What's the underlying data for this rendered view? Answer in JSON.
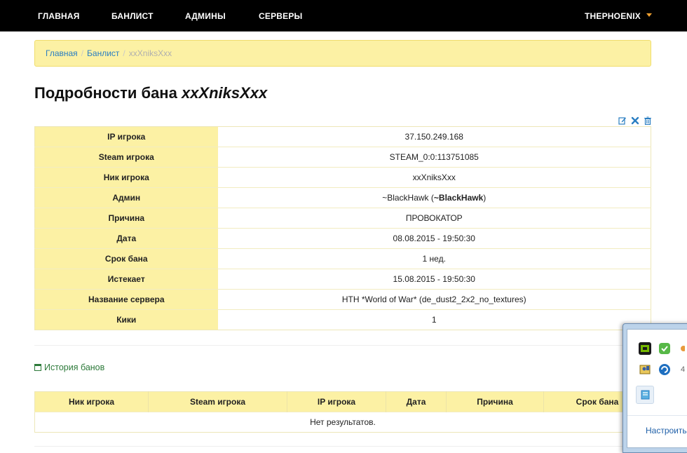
{
  "nav": {
    "items": [
      "ГЛАВНАЯ",
      "БАНЛИСТ",
      "АДМИНЫ",
      "СЕРВЕРЫ"
    ],
    "user": "THEPHOENIX"
  },
  "breadcrumb": {
    "items": [
      "Главная",
      "Банлист"
    ],
    "current": "xxXniksXxx"
  },
  "title": {
    "prefix": "Подробности бана",
    "name": "xxXniksXxx"
  },
  "actions": [
    "edit-icon",
    "unban-icon",
    "delete-icon"
  ],
  "details": [
    {
      "label": "IP игрока",
      "value": "37.150.249.168"
    },
    {
      "label": "Steam игрока",
      "value": "STEAM_0:0:113751085"
    },
    {
      "label": "Ник игрока",
      "value": "xxXniksXxx"
    },
    {
      "label": "Админ",
      "value": "~BlackHawk (",
      "value_bold": "~BlackHawk",
      "value_suffix": ")"
    },
    {
      "label": "Причина",
      "value": "ПРОВОКАТОР"
    },
    {
      "label": "Дата",
      "value": "08.08.2015 - 19:50:30"
    },
    {
      "label": "Срок бана",
      "value": "1 нед."
    },
    {
      "label": "Истекает",
      "value": "15.08.2015 - 19:50:30"
    },
    {
      "label": "Название сервера",
      "value": "HTH *World of War* (de_dust2_2x2_no_textures)"
    },
    {
      "label": "Кики",
      "value": "1"
    }
  ],
  "history": {
    "label": "История банов",
    "columns": [
      "Ник игрока",
      "Steam игрока",
      "IP игрока",
      "Дата",
      "Причина",
      "Срок бана"
    ],
    "empty": "Нет результатов."
  },
  "tray": {
    "link": "Настроить...",
    "icons": [
      "nvidia-icon",
      "shield-check-icon",
      "app-icon",
      "user-card-icon",
      "refresh-icon",
      "notes-icon"
    ],
    "extra_text": "4"
  }
}
